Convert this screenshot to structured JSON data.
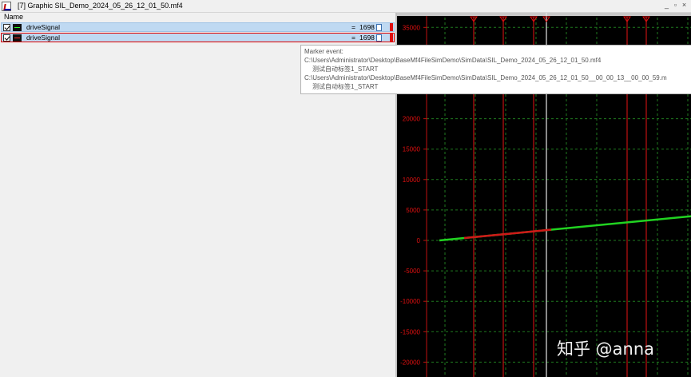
{
  "window": {
    "title": "[7] Graphic SIL_Demo_2024_05_26_12_01_50.mf4",
    "controls": [
      "_",
      "▫",
      "×"
    ]
  },
  "signal_list": {
    "header": "Name",
    "rows": [
      {
        "name": "driveSignal",
        "eq": "=",
        "value": "1698",
        "icon_color": "green"
      },
      {
        "name": "driveSignal",
        "eq": "=",
        "value": "1698",
        "icon_color": "red"
      }
    ]
  },
  "tooltip": {
    "lines": [
      "Marker event:",
      "C:\\Users\\Administrator\\Desktop\\BaseMf4FileSimDemo\\SimData\\SIL_Demo_2024_05_26_12_01_50.mf4",
      "测试自动标签1_START",
      "C:\\Users\\Administrator\\Desktop\\BaseMf4FileSimDemo\\SimData\\SIL_Demo_2024_05_26_12_01_50__00_00_13__00_00_59.m",
      "测试自动标签1_START"
    ]
  },
  "chart_data": {
    "type": "line",
    "y_ticks": [
      "35000",
      "20000",
      "15000",
      "10000",
      "5000",
      "0",
      "-5000",
      "-10000",
      "-15000",
      "-20000"
    ],
    "ylim": [
      -20000,
      35000
    ],
    "grid": true,
    "series": [
      {
        "color": "#21d321",
        "points": [
          [
            0,
            0
          ],
          [
            1,
            1698
          ],
          [
            2,
            4000
          ]
        ]
      },
      {
        "color": "#d01818",
        "points": [
          [
            0.2,
            300
          ],
          [
            1,
            1698
          ]
        ]
      }
    ],
    "markers": 6
  },
  "watermark": "知乎 @anna"
}
